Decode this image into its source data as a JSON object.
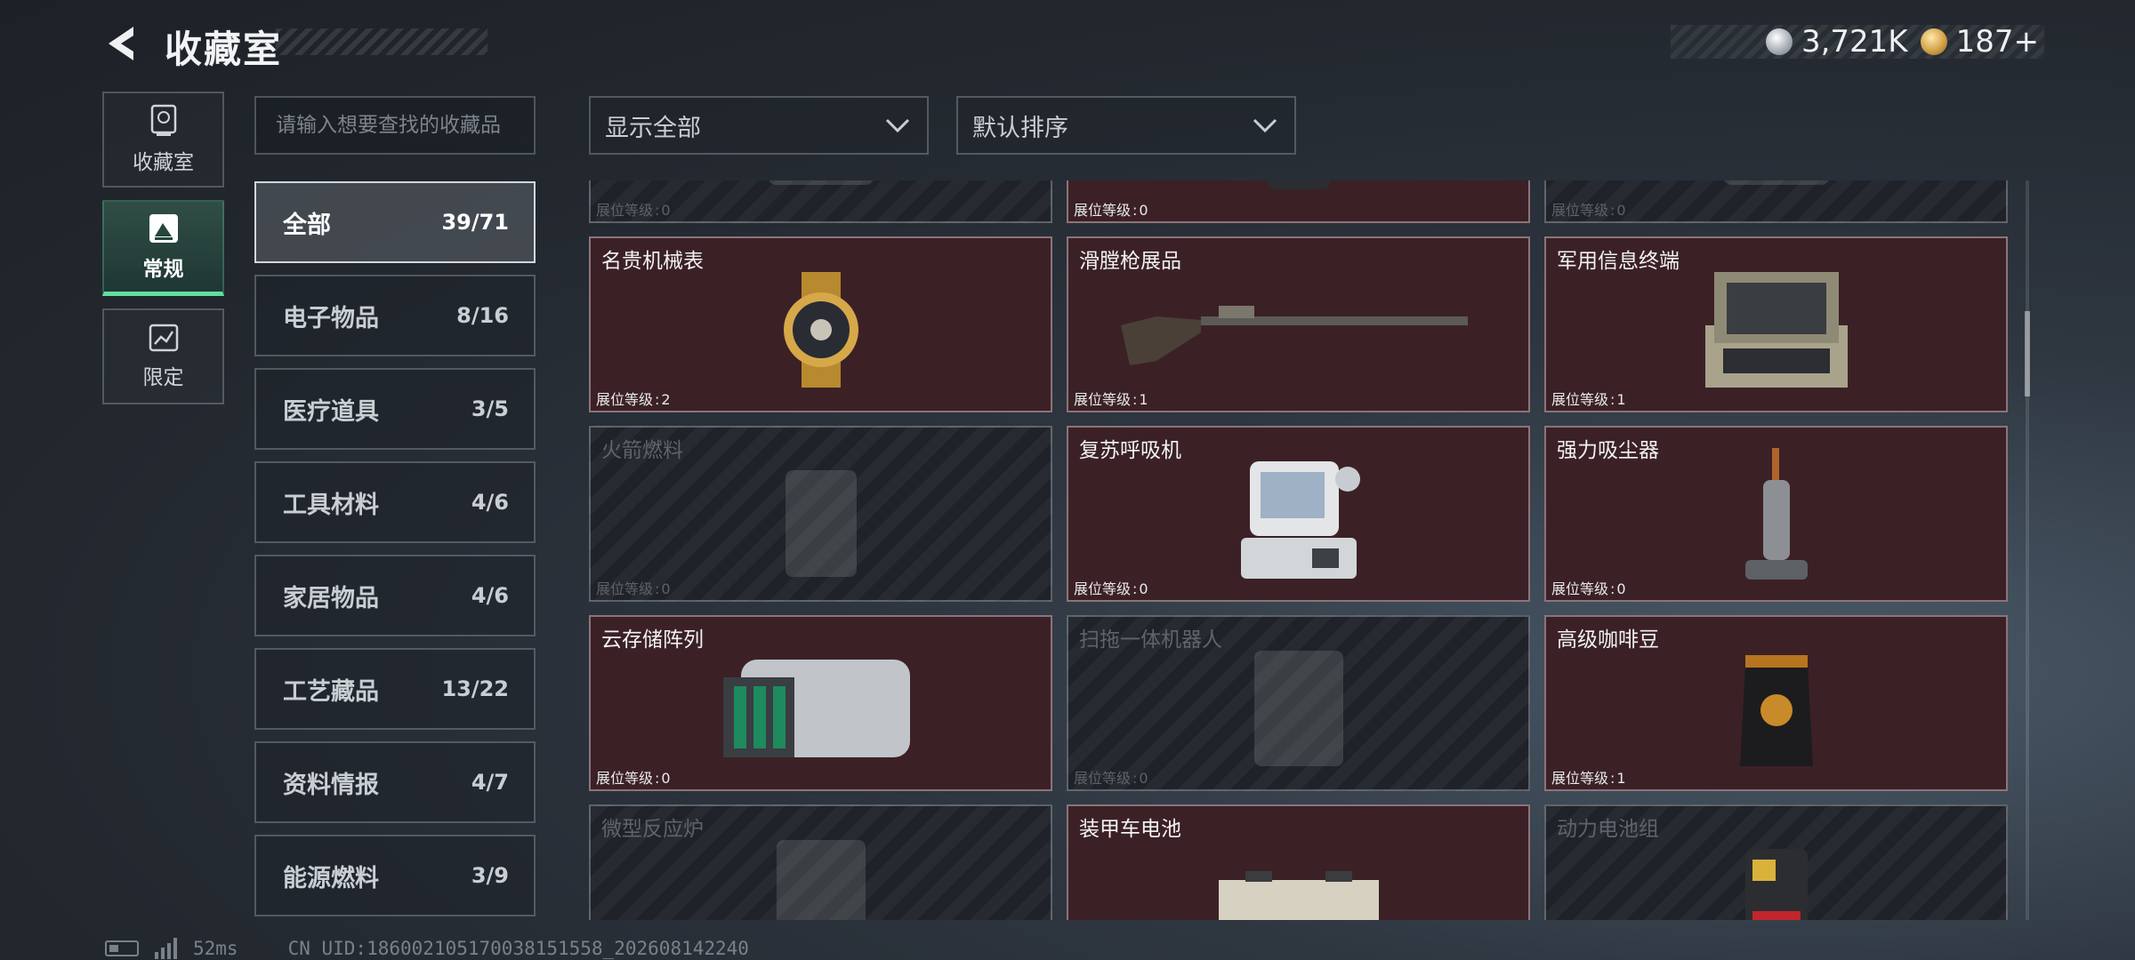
{
  "header": {
    "title": "收藏室",
    "currency": [
      {
        "icon": "silver-coin-icon",
        "value": "3,721K"
      },
      {
        "icon": "gold-coin-icon",
        "value": "187+"
      }
    ]
  },
  "nav_tabs": [
    {
      "label": "收藏室",
      "icon": "trophy-icon",
      "active": false
    },
    {
      "label": "常规",
      "icon": "picture-icon",
      "active": true
    },
    {
      "label": "限定",
      "icon": "chart-icon",
      "active": false
    }
  ],
  "search": {
    "placeholder": "请输入想要查找的收藏品",
    "value": ""
  },
  "filters": {
    "show_label": "显示全部",
    "sort_label": "默认排序"
  },
  "categories": [
    {
      "label": "全部",
      "count": "39/71",
      "active": true
    },
    {
      "label": "电子物品",
      "count": "8/16",
      "active": false
    },
    {
      "label": "医疗道具",
      "count": "3/5",
      "active": false
    },
    {
      "label": "工具材料",
      "count": "4/6",
      "active": false
    },
    {
      "label": "家居物品",
      "count": "4/6",
      "active": false
    },
    {
      "label": "工艺藏品",
      "count": "13/22",
      "active": false
    },
    {
      "label": "资料情报",
      "count": "4/7",
      "active": false
    },
    {
      "label": "能源燃料",
      "count": "3/9",
      "active": false
    }
  ],
  "level_prefix": "展位等级",
  "level_separator": ":",
  "items": [
    {
      "name": "",
      "level": "0",
      "owned": false,
      "art": "device-icon"
    },
    {
      "name": "",
      "level": "0",
      "owned": true,
      "art": "battery-pack-icon"
    },
    {
      "name": "",
      "level": "0",
      "owned": false,
      "art": "device-icon"
    },
    {
      "name": "名贵机械表",
      "level": "2",
      "owned": true,
      "art": "watch-icon"
    },
    {
      "name": "滑膛枪展品",
      "level": "1",
      "owned": true,
      "art": "musket-icon"
    },
    {
      "name": "军用信息终端",
      "level": "1",
      "owned": true,
      "art": "terminal-case-icon"
    },
    {
      "name": "火箭燃料",
      "level": "0",
      "owned": false,
      "art": "fuel-can-icon"
    },
    {
      "name": "复苏呼吸机",
      "level": "0",
      "owned": true,
      "art": "ventilator-icon"
    },
    {
      "name": "强力吸尘器",
      "level": "0",
      "owned": true,
      "art": "vacuum-icon"
    },
    {
      "name": "云存储阵列",
      "level": "0",
      "owned": true,
      "art": "server-array-icon"
    },
    {
      "name": "扫拖一体机器人",
      "level": "0",
      "owned": false,
      "art": "robot-vacuum-icon"
    },
    {
      "name": "高级咖啡豆",
      "level": "1",
      "owned": true,
      "art": "coffee-bag-icon"
    },
    {
      "name": "微型反应炉",
      "level": "",
      "owned": false,
      "art": "reactor-icon"
    },
    {
      "name": "装甲车电池",
      "level": "",
      "owned": true,
      "art": "car-battery-icon"
    },
    {
      "name": "动力电池组",
      "level": "",
      "owned": false,
      "art": "battery-pack-icon"
    }
  ],
  "footer": {
    "ping": "52ms",
    "uid": "CN UID:1860021051700381515​58_202608142240"
  }
}
